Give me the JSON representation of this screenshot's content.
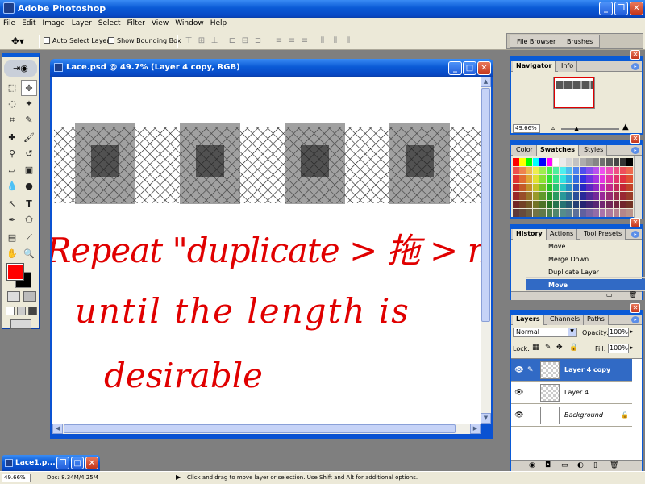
{
  "app": {
    "title": "Adobe Photoshop"
  },
  "menu": [
    "File",
    "Edit",
    "Image",
    "Layer",
    "Select",
    "Filter",
    "View",
    "Window",
    "Help"
  ],
  "options": {
    "auto_select": "Auto Select Layer",
    "show_bbox": "Show Bounding Box"
  },
  "palette_well": {
    "file_browser": "File Browser",
    "brushes": "Brushes"
  },
  "document": {
    "title": "Lace.psd @ 49.7% (Layer 4 copy, RGB)"
  },
  "annotation": {
    "line1": "Repeat \"duplicate > 拖 > merge\"",
    "line2": "until the length is",
    "line3": "desirable",
    "color": "#e00000"
  },
  "navigator": {
    "tabs": [
      "Navigator",
      "Info"
    ],
    "zoom": "49.66%"
  },
  "swatches": {
    "tabs": [
      "Color",
      "Swatches",
      "Styles"
    ]
  },
  "history": {
    "tabs": [
      "History",
      "Actions",
      "Tool Presets"
    ],
    "items": [
      "Move",
      "Merge Down",
      "Duplicate Layer",
      "Move"
    ]
  },
  "layers": {
    "tabs": [
      "Layers",
      "Channels",
      "Paths"
    ],
    "blend_mode": "Normal",
    "opacity_label": "Opacity:",
    "opacity": "100%",
    "lock_label": "Lock:",
    "fill_label": "Fill:",
    "fill": "100%",
    "items": [
      "Layer 4 copy",
      "Layer 4",
      "Background"
    ]
  },
  "colors": {
    "foreground": "#ff0000",
    "background": "#000000",
    "accent": "#316ac5"
  },
  "minimized_doc": {
    "title": "Lace1.p..."
  },
  "status": {
    "zoom": "49.66%",
    "doc": "Doc: 8.34M/4.25M",
    "hint": "Click and drag to move layer or selection. Use Shift and Alt for additional options."
  }
}
